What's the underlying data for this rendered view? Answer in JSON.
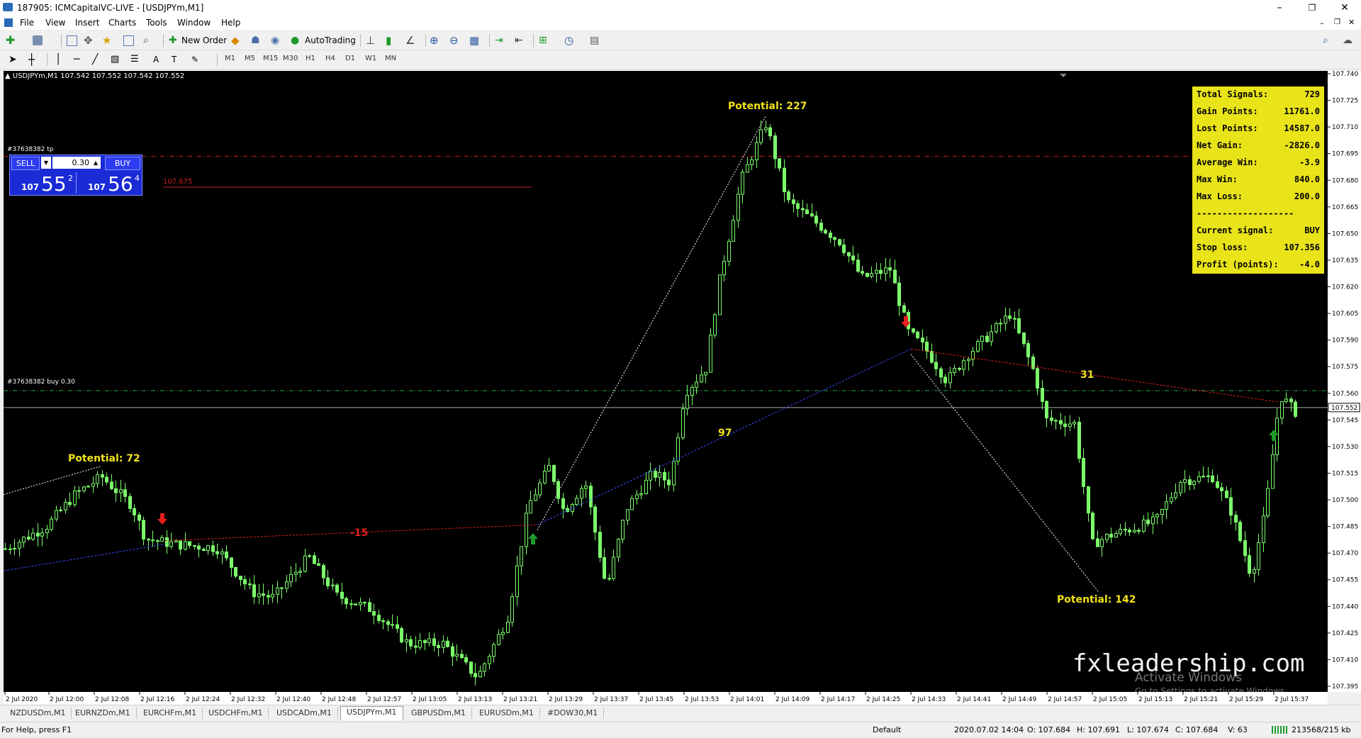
{
  "window": {
    "title": "187905: ICMCapitalVC-LIVE - [USDJPYm,M1]",
    "minimize": "–",
    "restore": "❐",
    "close": "✕"
  },
  "menu": [
    "File",
    "View",
    "Insert",
    "Charts",
    "Tools",
    "Window",
    "Help"
  ],
  "toolbar": {
    "new_order": "New Order",
    "auto_trading": "AutoTrading"
  },
  "timeframes": [
    "M1",
    "M5",
    "M15",
    "M30",
    "H1",
    "H4",
    "D1",
    "W1",
    "MN"
  ],
  "chart": {
    "header": "USDJPYm,M1  107.542 107.552 107.542 107.552",
    "tp_line_label": "#37638382 tp",
    "buy_line_label": "#37638382 buy 0.30",
    "level_label": "107.675",
    "current_price_label": "107.552",
    "annotations": {
      "potential_72": "Potential: 72",
      "potential_227": "Potential: 227",
      "potential_142": "Potential: 142",
      "minus15": "-15",
      "n97": "97",
      "n31": "31"
    },
    "watermark": "fxleadership.com",
    "activate1": "Activate Windows",
    "activate2": "Go to Settings to activate Windows."
  },
  "trade_panel": {
    "sell": "SELL",
    "buy": "BUY",
    "lot": "0.30",
    "sell_prefix": "107",
    "sell_big": "55",
    "sell_sup": "2",
    "buy_prefix": "107",
    "buy_big": "56",
    "buy_sup": "4"
  },
  "info_panel": {
    "rows": [
      {
        "k": "Total Signals:",
        "v": "729"
      },
      {
        "k": "Gain Points:",
        "v": "11761.0"
      },
      {
        "k": "Lost Points:",
        "v": "14587.0"
      },
      {
        "k": "Net Gain:",
        "v": "-2826.0"
      },
      {
        "k": "Average Win:",
        "v": "-3.9"
      },
      {
        "k": "Max Win:",
        "v": "840.0"
      },
      {
        "k": "Max Loss:",
        "v": "200.0"
      },
      {
        "k": "-------------------",
        "v": ""
      },
      {
        "k": "Current signal:",
        "v": "BUY"
      },
      {
        "k": "Stop loss:",
        "v": "107.356"
      },
      {
        "k": "Profit (points):",
        "v": "-4.0"
      }
    ]
  },
  "price_ticks": [
    "107.740",
    "107.725",
    "107.710",
    "107.695",
    "107.680",
    "107.665",
    "107.650",
    "107.635",
    "107.620",
    "107.605",
    "107.590",
    "107.575",
    "107.560",
    "107.545",
    "107.530",
    "107.515",
    "107.500",
    "107.485",
    "107.470",
    "107.455",
    "107.440",
    "107.425",
    "107.410",
    "107.395"
  ],
  "time_ticks": [
    "2 Jul 2020",
    "2 Jul 12:00",
    "2 Jul 12:08",
    "2 Jul 12:16",
    "2 Jul 12:24",
    "2 Jul 12:32",
    "2 Jul 12:40",
    "2 Jul 12:48",
    "2 Jul 12:57",
    "2 Jul 13:05",
    "2 Jul 13:13",
    "2 Jul 13:21",
    "2 Jul 13:29",
    "2 Jul 13:37",
    "2 Jul 13:45",
    "2 Jul 13:53",
    "2 Jul 14:01",
    "2 Jul 14:09",
    "2 Jul 14:17",
    "2 Jul 14:25",
    "2 Jul 14:33",
    "2 Jul 14:41",
    "2 Jul 14:49",
    "2 Jul 14:57",
    "2 Jul 15:05",
    "2 Jul 15:13",
    "2 Jul 15:21",
    "2 Jul 15:29",
    "2 Jul 15:37"
  ],
  "tabs": [
    "NZDUSDm,M1",
    "EURNZDm,M1",
    "EURCHFm,M1",
    "USDCHFm,M1",
    "USDCADm,M1",
    "USDJPYm,M1",
    "GBPUSDm,M1",
    "EURUSDm,M1",
    "#DOW30,M1"
  ],
  "active_tab": 5,
  "status": {
    "help": "For Help, press F1",
    "profile": "Default",
    "datetime": "2020.07.02 14:04",
    "open": "O: 107.684",
    "high": "H: 107.691",
    "low": "L: 107.674",
    "close": "C: 107.684",
    "volume": "V: 63",
    "traffic": "213568/215 kb"
  },
  "colors": {
    "candle": "#7cff6b",
    "panel": "#e9e31a",
    "tp_line": "#c81e1e",
    "buy_line": "#22a84a"
  }
}
